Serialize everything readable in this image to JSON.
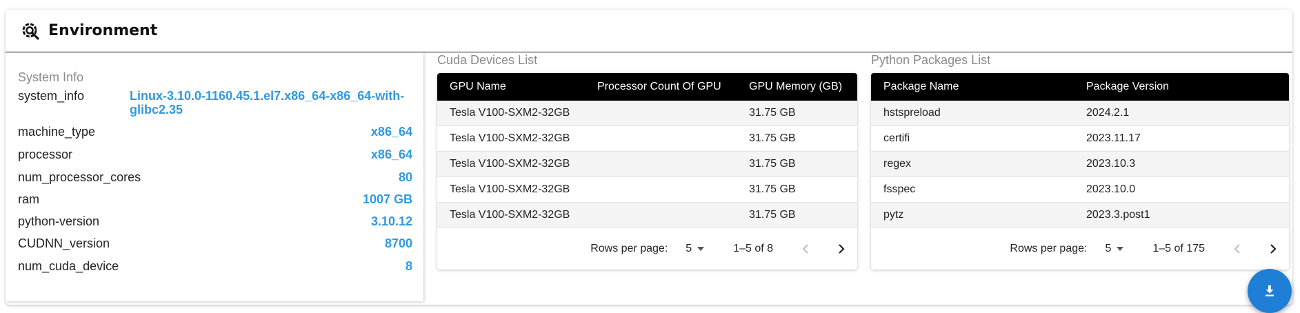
{
  "header": {
    "title": "Environment",
    "icon": "settings-search-icon"
  },
  "system_info": {
    "title": "System Info",
    "rows": [
      {
        "key": "system_info",
        "value": "Linux-3.10.0-1160.45.1.el7.x86_64-x86_64-with-glibc2.35"
      },
      {
        "key": "machine_type",
        "value": "x86_64"
      },
      {
        "key": "processor",
        "value": "x86_64"
      },
      {
        "key": "num_processor_cores",
        "value": "80"
      },
      {
        "key": "ram",
        "value": "1007 GB"
      },
      {
        "key": "python-version",
        "value": "3.10.12"
      },
      {
        "key": "CUDNN_version",
        "value": "8700"
      },
      {
        "key": "num_cuda_device",
        "value": "8"
      }
    ]
  },
  "cuda": {
    "title": "Cuda Devices List",
    "columns": [
      "GPU Name",
      "Processor Count Of GPU",
      "GPU Memory (GB)"
    ],
    "rows": [
      [
        "Tesla V100-SXM2-32GB",
        "",
        "31.75 GB"
      ],
      [
        "Tesla V100-SXM2-32GB",
        "",
        "31.75 GB"
      ],
      [
        "Tesla V100-SXM2-32GB",
        "",
        "31.75 GB"
      ],
      [
        "Tesla V100-SXM2-32GB",
        "",
        "31.75 GB"
      ],
      [
        "Tesla V100-SXM2-32GB",
        "",
        "31.75 GB"
      ]
    ],
    "pager": {
      "rows_label": "Rows per page:",
      "rows_value": "5",
      "range": "1–5 of 8"
    }
  },
  "packages": {
    "title": "Python Packages List",
    "columns": [
      "Package Name",
      "Package Version"
    ],
    "rows": [
      [
        "hstspreload",
        "2024.2.1"
      ],
      [
        "certifi",
        "2023.11.17"
      ],
      [
        "regex",
        "2023.10.3"
      ],
      [
        "fsspec",
        "2023.10.0"
      ],
      [
        "pytz",
        "2023.3.post1"
      ]
    ],
    "pager": {
      "rows_label": "Rows per page:",
      "rows_value": "5",
      "range": "1–5 of 175"
    }
  },
  "fab": {
    "icon": "download-icon"
  },
  "colors": {
    "accent": "#2f9ae0",
    "fab": "#1f7fd6",
    "header_bg": "#000000"
  }
}
